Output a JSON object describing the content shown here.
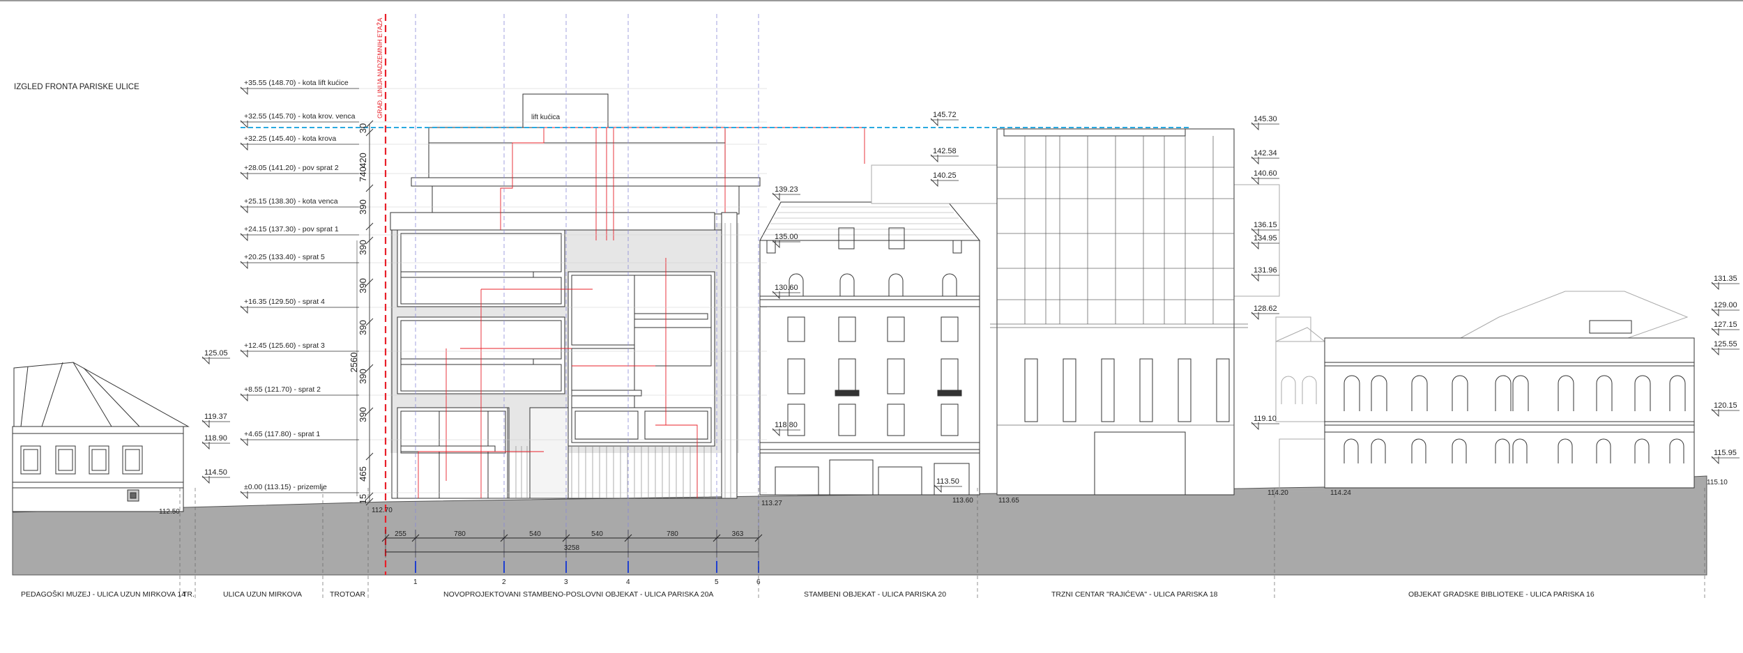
{
  "title": "IZGLED FRONTA PARISKE ULICE",
  "red_line_label": "GRAĐ. LINIJA NADZEMNIH ETAŽA",
  "lift_label": "lift kućica",
  "levels": [
    {
      "text": "+35.55 (148.70) - kota lift kućice"
    },
    {
      "text": "+32.55 (145.70) - kota krov. venca"
    },
    {
      "text": "+32.25 (145.40) - kota krova"
    },
    {
      "text": "+28.05 (141.20) - pov sprat 2"
    },
    {
      "text": "+25.15 (138.30) - kota venca"
    },
    {
      "text": "+24.15 (137.30) - pov sprat 1"
    },
    {
      "text": "+20.25 (133.40) - sprat 5"
    },
    {
      "text": "+16.35 (129.50) - sprat 4"
    },
    {
      "text": "+12.45 (125.60) - sprat 3"
    },
    {
      "text": "+8.55 (121.70) - sprat 2"
    },
    {
      "text": "+4.65 (117.80) - sprat 1"
    },
    {
      "text": "±0.00 (113.15) - prizemlje"
    }
  ],
  "vertical_dims": [
    "30",
    "420",
    "740",
    "390",
    "390",
    "390",
    "390",
    "2560",
    "390",
    "390",
    "465",
    "15"
  ],
  "horizontal_dims": [
    "255",
    "780",
    "540",
    "540",
    "780",
    "363"
  ],
  "total_width": "3258",
  "axis_numbers": [
    "1",
    "2",
    "3",
    "4",
    "5",
    "6"
  ],
  "elevation_marks": [
    {
      "text": "125.05"
    },
    {
      "text": "119.37"
    },
    {
      "text": "118.90"
    },
    {
      "text": "114.50"
    },
    {
      "text": "145.72"
    },
    {
      "text": "142.58"
    },
    {
      "text": "140.25"
    },
    {
      "text": "139.23"
    },
    {
      "text": "135.00"
    },
    {
      "text": "130.60"
    },
    {
      "text": "118.80"
    },
    {
      "text": "113.50"
    },
    {
      "text": "145.30"
    },
    {
      "text": "142.34"
    },
    {
      "text": "140.60"
    },
    {
      "text": "136.15"
    },
    {
      "text": "134.95"
    },
    {
      "text": "131.96"
    },
    {
      "text": "128.62"
    },
    {
      "text": "119.10"
    },
    {
      "text": "131.35"
    },
    {
      "text": "129.00"
    },
    {
      "text": "127.15"
    },
    {
      "text": "125.55"
    },
    {
      "text": "120.15"
    },
    {
      "text": "115.95"
    }
  ],
  "ground_marks": [
    "112.50",
    "112.70",
    "113.27",
    "113.60",
    "113.65",
    "114.20",
    "114.24",
    "115.10"
  ],
  "footer_labels": [
    "PEDAGOŠKI MUZEJ - ULICA UZUN MIRKOVA 14",
    "TR.",
    "ULICA UZUN MIRKOVA",
    "TROTOAR",
    "NOVOPROJEKTOVANI STAMBENO-POSLOVNI OBJEKAT - ULICA PARISKA 20A",
    "STAMBENI OBJEKAT - ULICA PARISKA 20",
    "TRZNI CENTAR \"RAJIĆEVA\" - ULICA PARISKA 18",
    "OBJEKAT GRADSKE BIBLIOTEKE - ULICA PARISKA 16"
  ],
  "colors": {
    "red_line": "#e8202a",
    "cyan_line": "#29a9e0",
    "axis_blue": "#1f3fd0",
    "ground": "#a9a9a9",
    "hatch": "#dadada"
  }
}
